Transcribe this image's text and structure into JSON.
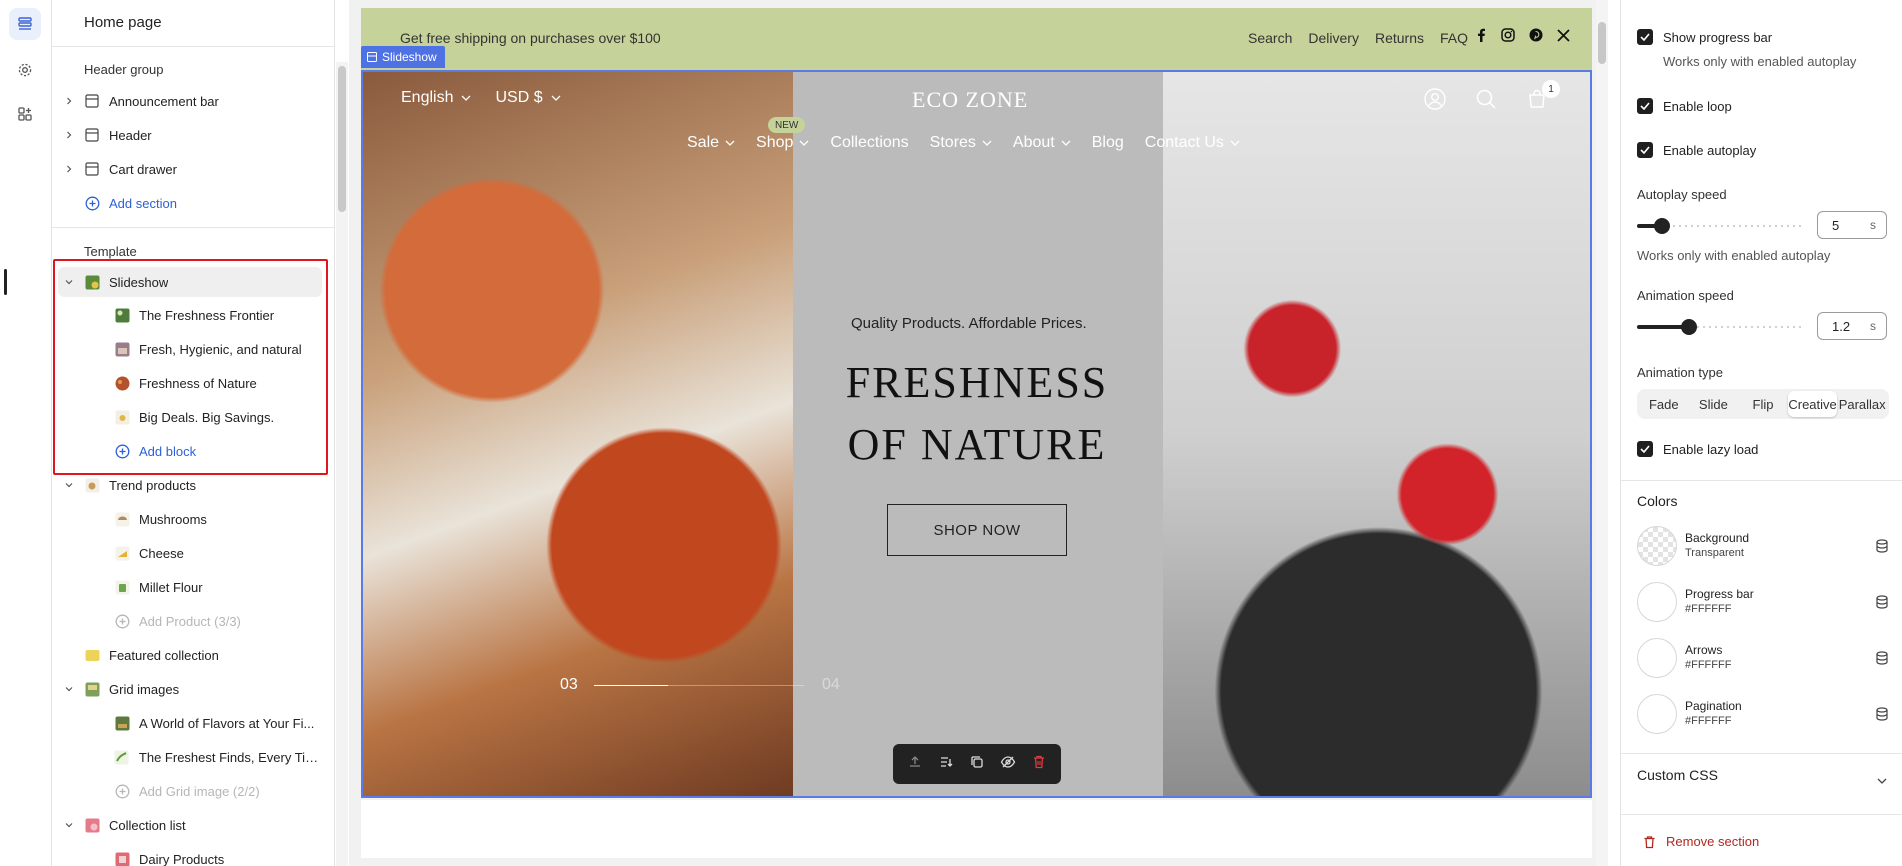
{
  "sidebar": {
    "title": "Home page",
    "header_group": {
      "label": "Header group",
      "items": [
        {
          "label": "Announcement bar"
        },
        {
          "label": "Header"
        },
        {
          "label": "Cart drawer"
        }
      ],
      "add_label": "Add section"
    },
    "template": {
      "label": "Template",
      "slideshow": {
        "label": "Slideshow",
        "blocks": [
          {
            "label": "The Freshness Frontier"
          },
          {
            "label": "Fresh, Hygienic, and natural"
          },
          {
            "label": "Freshness of Nature"
          },
          {
            "label": "Big Deals. Big Savings."
          }
        ],
        "add_label": "Add block"
      },
      "trend": {
        "label": "Trend products",
        "items": [
          {
            "label": "Mushrooms"
          },
          {
            "label": "Cheese"
          },
          {
            "label": "Millet Flour"
          }
        ],
        "add_label": "Add Product (3/3)"
      },
      "featured": {
        "label": "Featured collection"
      },
      "grid": {
        "label": "Grid images",
        "items": [
          {
            "label": "A World of Flavors at Your Fi..."
          },
          {
            "label": "The Freshest Finds, Every Time"
          }
        ],
        "add_label": "Add Grid image (2/2)"
      },
      "collection_list": {
        "label": "Collection list",
        "items": [
          {
            "label": "Dairy Products"
          }
        ]
      }
    }
  },
  "preview": {
    "announcement": {
      "text": "Get free shipping on purchases over $100",
      "links": [
        "Search",
        "Delivery",
        "Returns",
        "FAQ"
      ]
    },
    "section_tag": "Slideshow",
    "header": {
      "language": "English",
      "currency": "USD $",
      "logo": "ECO ZONE",
      "cart_count": "1",
      "nav": [
        "Sale",
        "Shop",
        "Collections",
        "Stores",
        "About",
        "Blog",
        "Contact Us"
      ],
      "nav_badge": "NEW"
    },
    "slide": {
      "subtitle": "Quality Products. Affordable Prices.",
      "headline_1": "FRESHNESS",
      "headline_2": "OF NATURE",
      "button": "SHOP NOW",
      "pagination_current": "03",
      "pagination_next": "04",
      "progress": 0.35
    }
  },
  "panel": {
    "show_progress_bar": {
      "label": "Show progress bar",
      "checked": true
    },
    "progress_note": "Works only with enabled autoplay",
    "enable_loop": {
      "label": "Enable loop",
      "checked": true
    },
    "enable_autoplay": {
      "label": "Enable autoplay",
      "checked": true
    },
    "autoplay_speed": {
      "label": "Autoplay speed",
      "value": "5",
      "unit": "s",
      "level": 0.15
    },
    "autoplay_note": "Works only with enabled autoplay",
    "animation_speed": {
      "label": "Animation speed",
      "value": "1.2",
      "unit": "s",
      "level": 0.32
    },
    "animation_type": {
      "label": "Animation type",
      "options": [
        "Fade",
        "Slide",
        "Flip",
        "Creative",
        "Parallax"
      ],
      "selected": "Creative"
    },
    "lazy_load": {
      "label": "Enable lazy load",
      "checked": true
    },
    "colors": {
      "heading": "Colors",
      "items": [
        {
          "name": "Background",
          "value": "Transparent"
        },
        {
          "name": "Progress bar",
          "value": "#FFFFFF"
        },
        {
          "name": "Arrows",
          "value": "#FFFFFF"
        },
        {
          "name": "Pagination",
          "value": "#FFFFFF"
        }
      ]
    },
    "custom_css": "Custom CSS",
    "remove_section": "Remove section"
  },
  "colors": {
    "accent": "#2c5fd9",
    "highlight": "#e0161f",
    "announcement_bg": "#c5d39a",
    "danger": "#b3261e"
  }
}
